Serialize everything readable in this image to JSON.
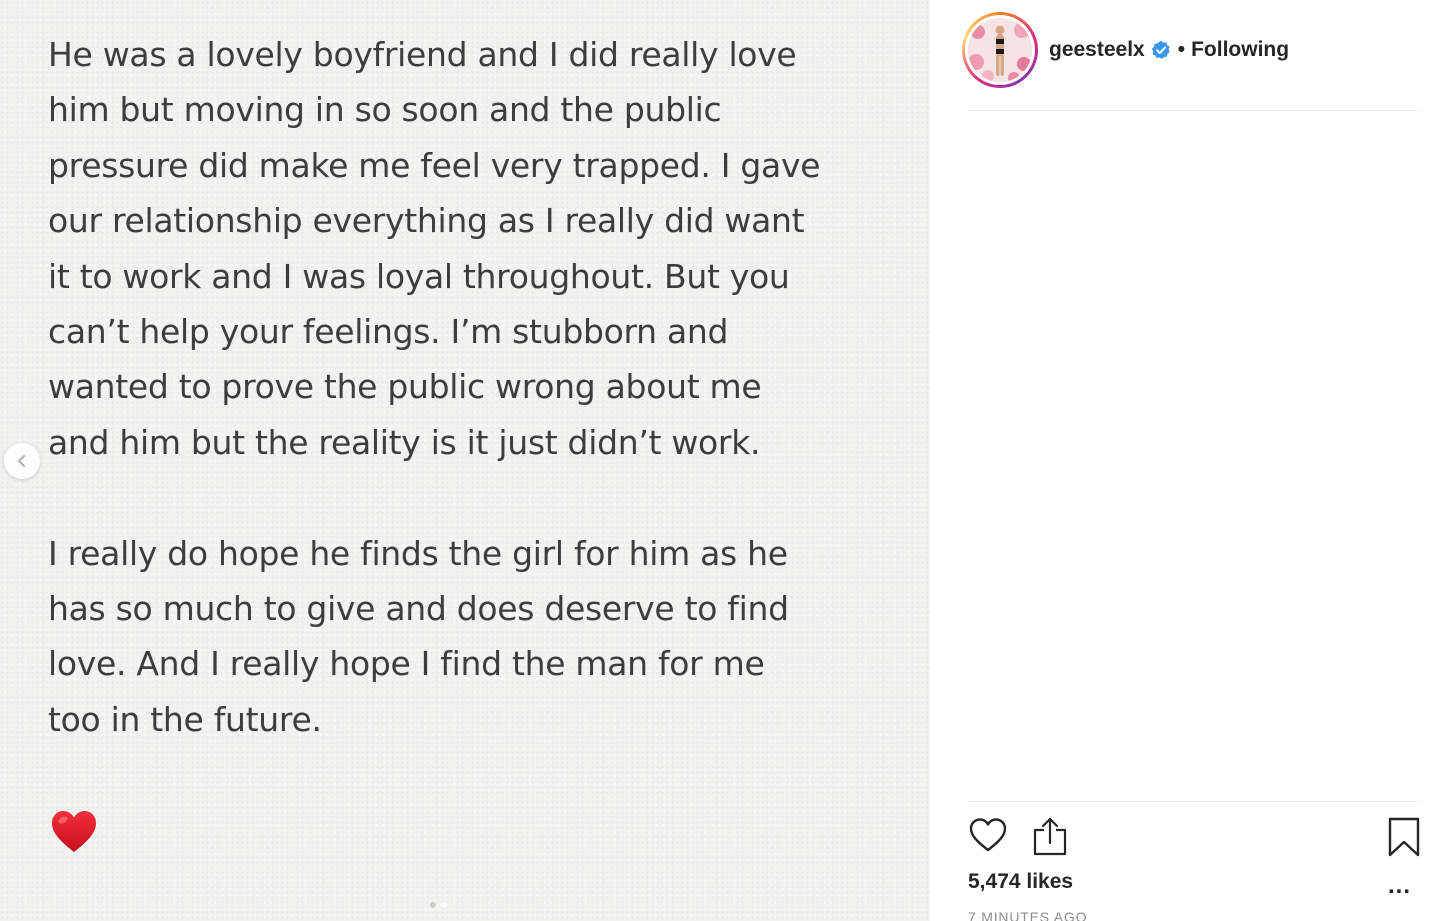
{
  "post": {
    "note_paragraphs": [
      "He was a lovely boyfriend and I did really love\nhim but moving in so soon and the public\npressure did make me feel very trapped. I gave\nour relationship everything as I really did want\nit to work and I was loyal throughout. But you\ncan’t help your feelings. I’m stubborn and\nwanted to prove the public wrong about me\nand him but the reality is it just didn’t work.",
      "I really do hope he finds the girl for him as he\nhas so much to give and does deserve to find\nlove. And I really hope I find the man for me\ntoo in the future."
    ],
    "emoji": "red-heart",
    "carousel_dots": 2,
    "carousel_active_index": 1
  },
  "header": {
    "username": "geesteelx",
    "separator": "•",
    "follow_status": "Following",
    "verified": true
  },
  "actions": {
    "icons": [
      "heart-icon",
      "share-icon",
      "bookmark-icon"
    ]
  },
  "stats": {
    "likes": "5,474 likes",
    "more": "...",
    "timestamp": "7 MINUTES AGO"
  },
  "colors": {
    "text": "#262626",
    "note_text": "#3d3d3d",
    "verified_blue": "#3897f0",
    "heart_red": "#e0161f"
  }
}
